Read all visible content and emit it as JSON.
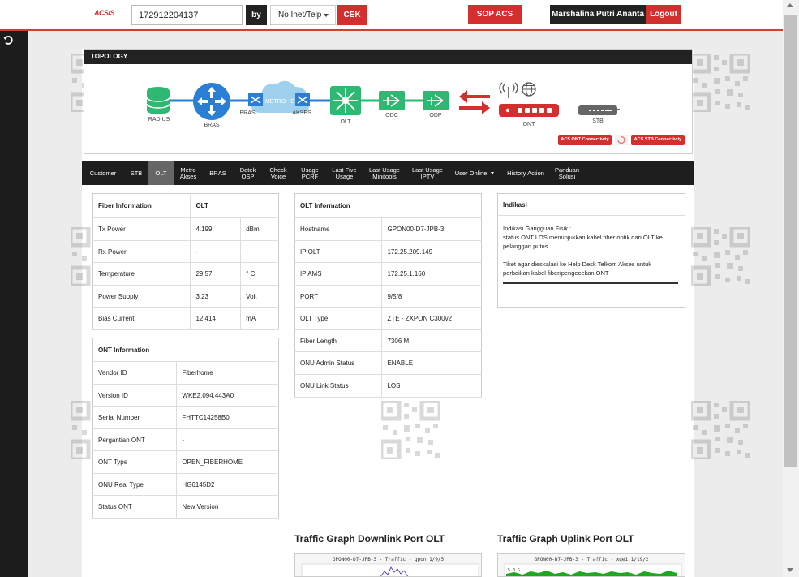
{
  "header": {
    "logo": "ACSIS",
    "search_value": "172912204137",
    "by_label": "by",
    "select_value": "No Inet/Telp",
    "cek_label": "CEK",
    "sop_label": "SOP ACS",
    "user_name": "Marshalina Putri Ananta",
    "logout_label": "Logout"
  },
  "topology": {
    "title": "TOPOLOGY",
    "nodes": {
      "radius": "RADIUS",
      "bras": "BRAS",
      "bras2": "BRAS",
      "metro": "METRO - E",
      "akses": "AKSES",
      "olt": "OLT",
      "odc": "ODC",
      "odp": "ODP",
      "ont": "ONT",
      "stb": "STB"
    },
    "acs_ont": "ACS ONT Connectivity",
    "acs_stb": "ACS STB Connectivity"
  },
  "tabs": [
    {
      "label": "Customer"
    },
    {
      "label": "STB"
    },
    {
      "label": "OLT",
      "active": true
    },
    {
      "label": "Metro Akses"
    },
    {
      "label": "BRAS"
    },
    {
      "label": "Datek OSP"
    },
    {
      "label": "Check Voice"
    },
    {
      "label": "Usage PCRF"
    },
    {
      "label": "Last Five Usage"
    },
    {
      "label": "Last Usage Minitools"
    },
    {
      "label": "Last Usage IPTV"
    },
    {
      "label": "User Online"
    },
    {
      "label": "History Action"
    },
    {
      "label": "Panduan Solusi"
    }
  ],
  "fiber": {
    "header": [
      "Fiber Information",
      "OLT"
    ],
    "rows": [
      [
        "Tx Power",
        "4.199",
        "dBm"
      ],
      [
        "Rx Power",
        "-",
        "-"
      ],
      [
        "Temperature",
        "29.57",
        "° C"
      ],
      [
        "Power Supply",
        "3.23",
        "Volt"
      ],
      [
        "Bias Current",
        "12.414",
        "mA"
      ]
    ]
  },
  "ont": {
    "header": "ONT Information",
    "rows": [
      [
        "Vendor ID",
        "Fiberhome"
      ],
      [
        "Version ID",
        "WKE2.094.443A0"
      ],
      [
        "Serial Number",
        "FHTTC14258B0"
      ],
      [
        "Pergantian ONT",
        "-"
      ],
      [
        "ONT Type",
        "OPEN_FIBERHOME"
      ],
      [
        "ONU Real Type",
        "HG6145D2"
      ],
      [
        "Status ONT",
        "New Version"
      ]
    ]
  },
  "olt": {
    "header": "OLT Information",
    "rows": [
      [
        "Hostname",
        "GPON00-D7-JPB-3"
      ],
      [
        "IP OLT",
        "172.25.209.149"
      ],
      [
        "IP AMS",
        "172.25.1.160"
      ],
      [
        "PORT",
        "9/5/8"
      ],
      [
        "OLT Type",
        "ZTE - ZXPON C300v2"
      ],
      [
        "Fiber Length",
        "7306 M"
      ],
      [
        "ONU Admin Status",
        "ENABLE"
      ],
      [
        "ONU Link Status",
        "LOS"
      ]
    ]
  },
  "indikasi": {
    "header": "Indikasi",
    "line1": "Indikasi Gangguan Fisik :",
    "line2": "status ONT LOS menunjukkan kabel fiber optik dari OLT ke pelanggan putus",
    "line3": "Tiket agar dieskalasi ke Help Desk Telkom Akses untuk perbaikan kabel fiber/pengecekan ONT"
  },
  "graphs": {
    "downlink_title": "Traffic Graph Downlink Port OLT",
    "uplink_title": "Traffic Graph Uplink Port OLT",
    "downlink_caption": "GPON00-D7-JPB-3 - Traffic - gpon_1/9/5",
    "uplink_caption": "GPON00-D7-JPB-3 - Traffic - xge1_1/19/2",
    "uplink_axis": "5.0 G"
  },
  "colors": {
    "accent": "#d32f2f",
    "dark": "#222222",
    "green": "#2eb872",
    "blue": "#2a7fd4"
  }
}
